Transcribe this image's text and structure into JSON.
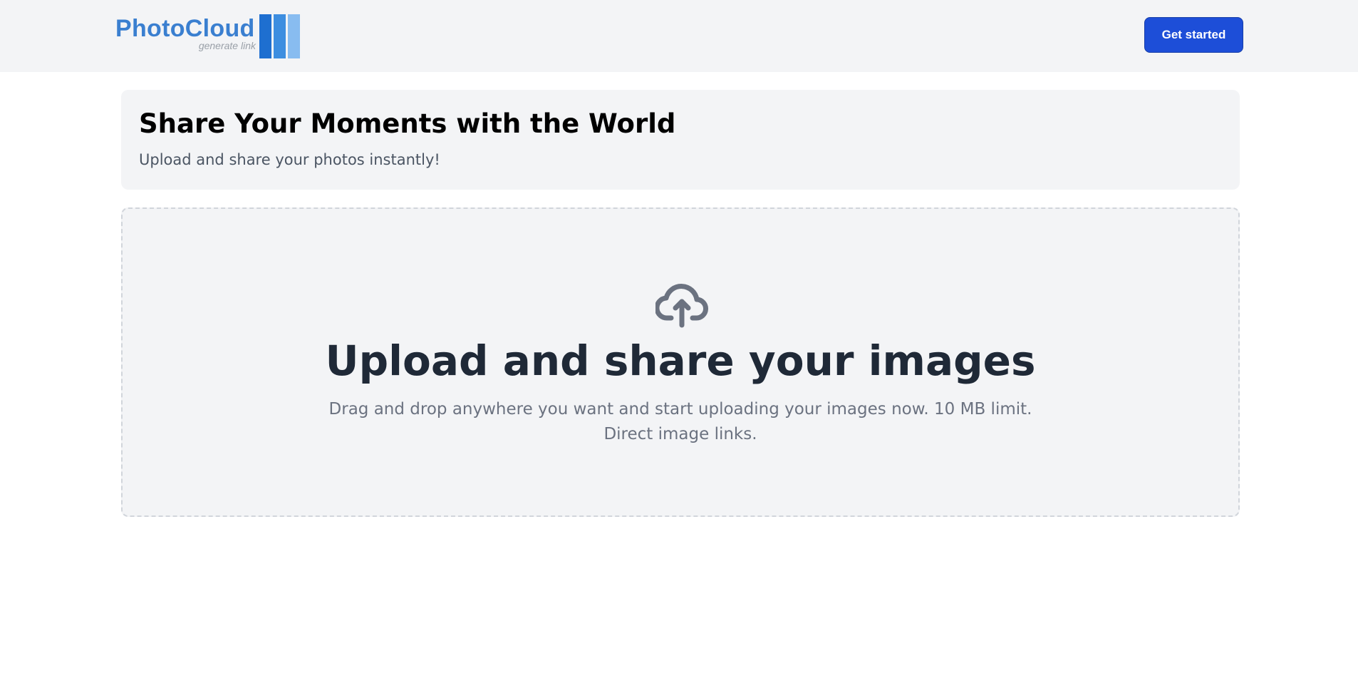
{
  "header": {
    "logo": {
      "name": "PhotoCloud",
      "tagline": "generate link"
    },
    "get_started_label": "Get started"
  },
  "hero": {
    "title": "Share Your Moments with the World",
    "subtitle": "Upload and share your photos instantly!"
  },
  "dropzone": {
    "icon": "cloud-upload-icon",
    "title": "Upload and share your images",
    "description": "Drag and drop anywhere you want and start uploading your images now. 10 MB limit. Direct image links."
  },
  "colors": {
    "primary_button": "#1d4ed8",
    "logo_blue": "#3a7fd0",
    "panel_background": "#f3f4f6",
    "icon_gray": "#6b7280"
  }
}
